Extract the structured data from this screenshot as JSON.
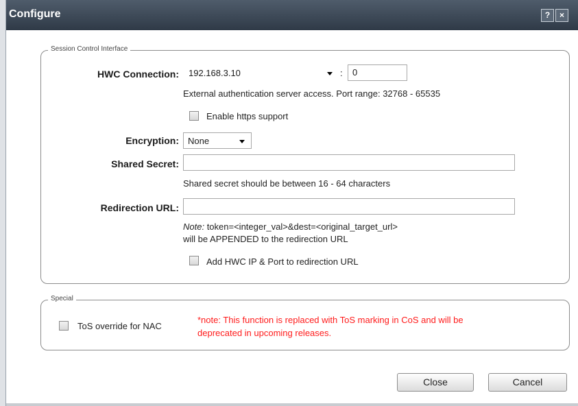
{
  "dialog": {
    "title": "Configure",
    "help_label": "?",
    "close_label": "×"
  },
  "session_group": {
    "legend": "Session Control Interface",
    "hwc_connection": {
      "label": "HWC Connection:",
      "ip_value": "192.168.3.10",
      "separator": ":",
      "port_value": "0",
      "help_text": "External authentication server access. Port range: 32768 - 65535"
    },
    "https_label": "Enable https support",
    "encryption": {
      "label": "Encryption:",
      "value": "None"
    },
    "shared_secret": {
      "label": "Shared Secret:",
      "value": "",
      "help_text": "Shared secret should be between 16 - 64 characters"
    },
    "redirection": {
      "label": "Redirection URL:",
      "value": "",
      "note_prefix": "Note:",
      "note_line1": " token=<integer_val>&dest=<original_target_url>",
      "note_line2": "will be APPENDED to the redirection URL",
      "add_ip_label": "Add HWC IP & Port to redirection URL"
    }
  },
  "special_group": {
    "legend": "Special",
    "tos_label": "ToS override for NAC",
    "note_line1": "*note: This function is replaced with ToS marking in CoS and will be",
    "note_line2": "deprecated in upcoming releases."
  },
  "buttons": {
    "close": "Close",
    "cancel": "Cancel"
  }
}
